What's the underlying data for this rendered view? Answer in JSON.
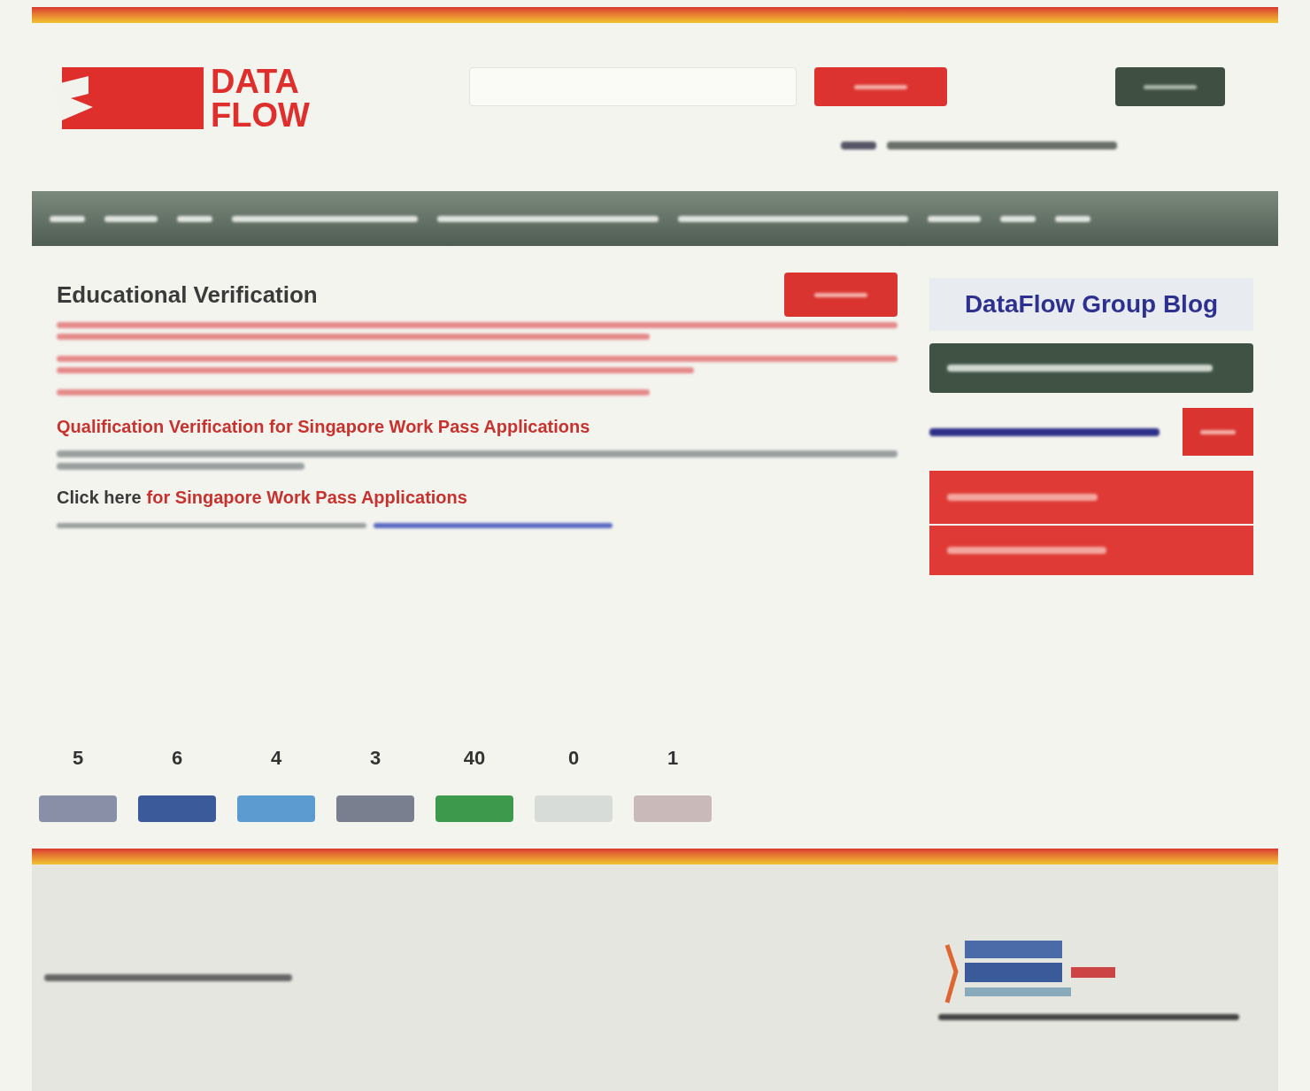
{
  "logo": {
    "line1": "DATA",
    "line2": "FLOW"
  },
  "content": {
    "title": "Educational Verification",
    "section_heading": "Qualification Verification for Singapore Work Pass Applications",
    "link_prefix": "Click here",
    "link_text": "for Singapore Work Pass Applications"
  },
  "sidebar": {
    "blog_title": "DataFlow Group Blog"
  },
  "share": [
    {
      "count": "5",
      "color": "#8a8fa8"
    },
    {
      "count": "6",
      "color": "#3b5a9a"
    },
    {
      "count": "4",
      "color": "#5b9bcf"
    },
    {
      "count": "3",
      "color": "#7a7f90"
    },
    {
      "count": "40",
      "color": "#3d9a4c"
    },
    {
      "count": "0",
      "color": "#d8dcd8"
    },
    {
      "count": "1",
      "color": "#c9b9b9"
    }
  ]
}
